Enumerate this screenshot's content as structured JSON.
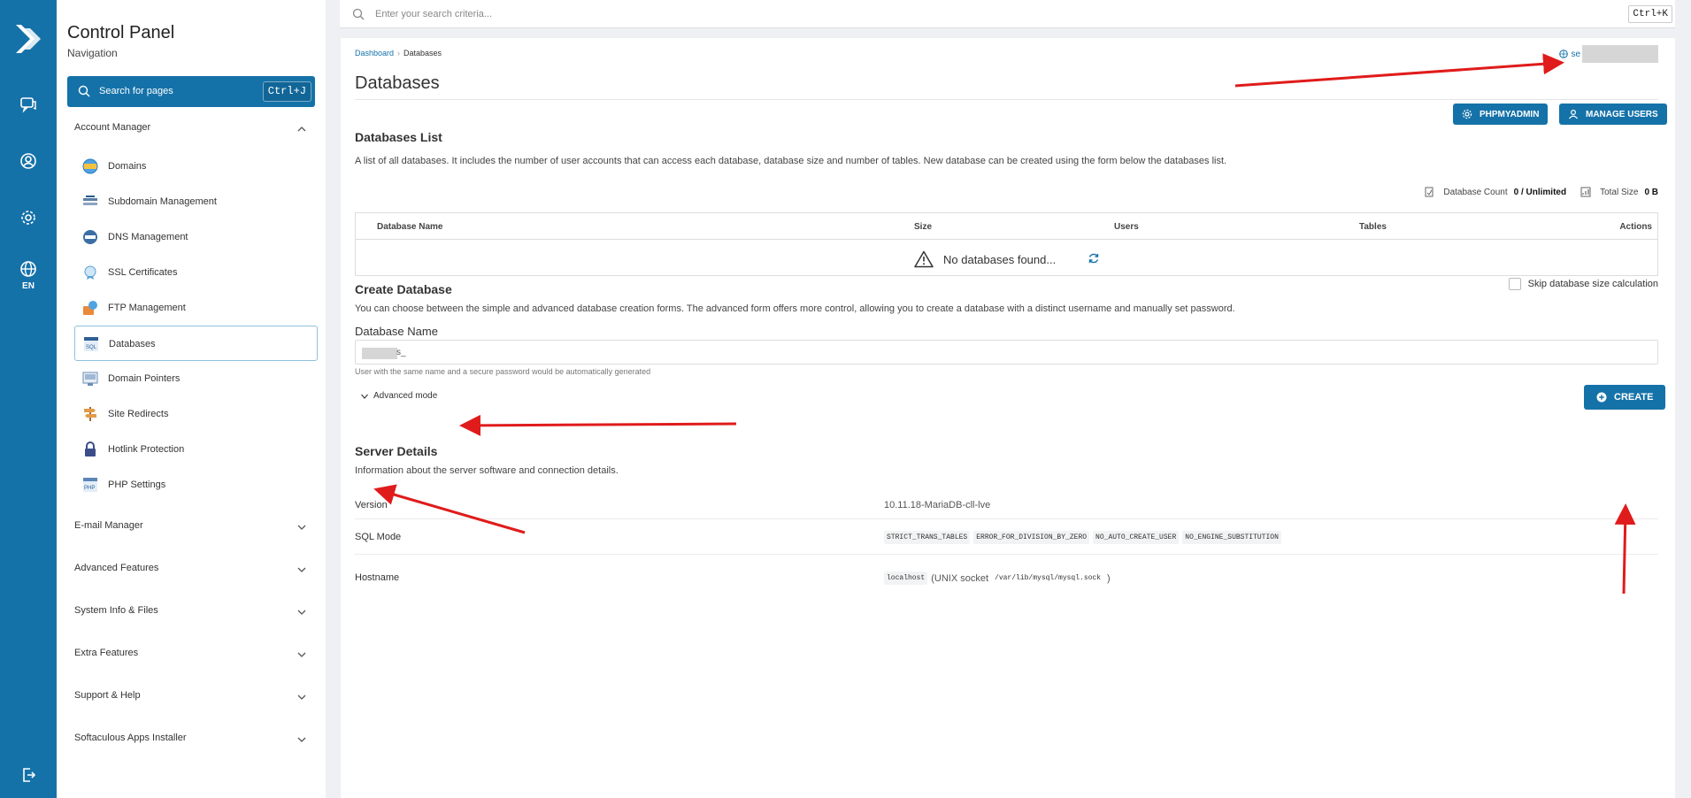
{
  "rail": {
    "lang": "EN"
  },
  "sidebar": {
    "title": "Control Panel",
    "subtitle": "Navigation",
    "search": {
      "label": "Search for pages",
      "shortcut": "Ctrl+J"
    },
    "sections": [
      {
        "label": "Account Manager",
        "expanded": true
      },
      {
        "label": "E-mail Manager",
        "expanded": false
      },
      {
        "label": "Advanced Features",
        "expanded": false
      },
      {
        "label": "System Info & Files",
        "expanded": false
      },
      {
        "label": "Extra Features",
        "expanded": false
      },
      {
        "label": "Support & Help",
        "expanded": false
      },
      {
        "label": "Softaculous Apps Installer",
        "expanded": false
      }
    ],
    "items": [
      {
        "label": "Domains",
        "icon": "domains-icon"
      },
      {
        "label": "Subdomain Management",
        "icon": "subdomain-icon"
      },
      {
        "label": "DNS Management",
        "icon": "dns-icon"
      },
      {
        "label": "SSL Certificates",
        "icon": "ssl-icon"
      },
      {
        "label": "FTP Management",
        "icon": "ftp-icon"
      },
      {
        "label": "Databases",
        "icon": "sql-icon",
        "active": true
      },
      {
        "label": "Domain Pointers",
        "icon": "domain-pointers-icon"
      },
      {
        "label": "Site Redirects",
        "icon": "signpost-icon"
      },
      {
        "label": "Hotlink Protection",
        "icon": "lock-icon"
      },
      {
        "label": "PHP Settings",
        "icon": "php-icon"
      }
    ]
  },
  "topbar": {
    "placeholder": "Enter your search criteria...",
    "shortcut": "Ctrl+K"
  },
  "main": {
    "breadcrumb": [
      "Dashboard",
      "Databases"
    ],
    "host_prefix": "se",
    "title": "Databases",
    "buttons": {
      "phpmyadmin": "PHPMYADMIN",
      "manage_users": "MANAGE USERS",
      "create": "CREATE"
    },
    "list": {
      "heading": "Databases List",
      "description": "A list of all databases. It includes the number of user accounts that can access each database, database size and number of tables. New database can be created using the form below the databases list.",
      "count_label": "Database Count",
      "count_value": "0 / Unlimited",
      "size_label": "Total Size",
      "size_value": "0 B",
      "columns": [
        "Database Name",
        "Size",
        "Users",
        "Tables",
        "Actions"
      ],
      "empty_text": "No databases found...",
      "skip_label": "Skip database size calculation"
    },
    "create": {
      "heading": "Create Database",
      "description": "You can choose between the simple and advanced database creation forms. The advanced form offers more control, allowing you to create a database with a distinct username and manually set password.",
      "field_label": "Database Name",
      "field_value": "s_",
      "hint": "User with the same name and a secure password would be automatically generated",
      "advanced_label": "Advanced mode"
    },
    "server": {
      "heading": "Server Details",
      "description": "Information about the server software and connection details.",
      "version_label": "Version",
      "version_value": "10.11.18-MariaDB-cll-lve",
      "sqlmode_label": "SQL Mode",
      "sqlmodes": [
        "STRICT_TRANS_TABLES",
        "ERROR_FOR_DIVISION_BY_ZERO",
        "NO_AUTO_CREATE_USER",
        "NO_ENGINE_SUBSTITUTION"
      ],
      "hostname_label": "Hostname",
      "hostname_code": "localhost",
      "socket_prefix": "(UNIX socket",
      "socket_code": "/var/lib/mysql/mysql.sock",
      "socket_suffix": ")"
    }
  },
  "colors": {
    "brand": "#1572a9",
    "annotation": "#e01b1b"
  }
}
